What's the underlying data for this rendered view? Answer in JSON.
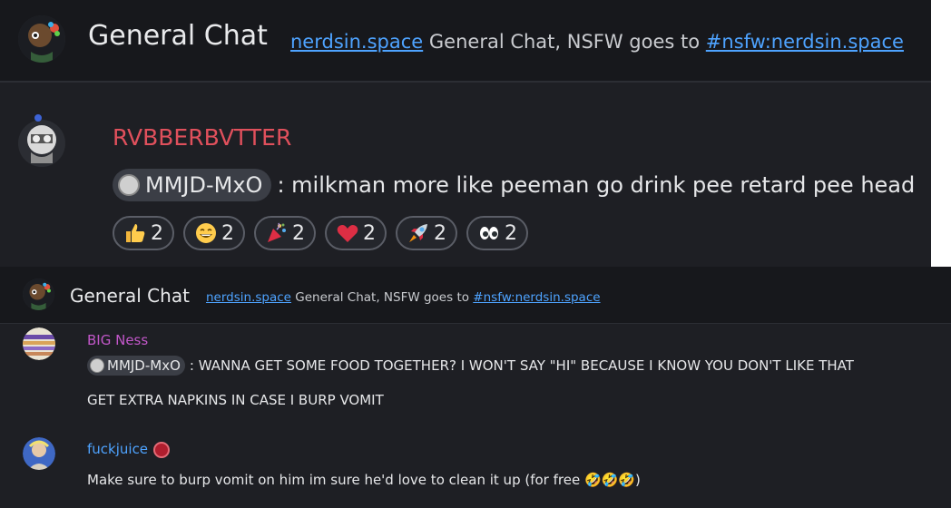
{
  "panel_zoomed": {
    "room": {
      "title": "General Chat",
      "topic_link1": "nerdsin.space",
      "topic_text": "General Chat, NSFW goes to",
      "topic_link2": "#nsfw:nerdsin.space"
    },
    "message": {
      "sender": "RVBBERBVTTER",
      "mention": "MMJD-MxO",
      "text": ": milkman more like peeman go drink pee retard pee head",
      "reactions": [
        {
          "emoji": "thumbs-up",
          "count": "2"
        },
        {
          "emoji": "grinning-face",
          "count": "2"
        },
        {
          "emoji": "party-popper",
          "count": "2"
        },
        {
          "emoji": "red-heart",
          "count": "2"
        },
        {
          "emoji": "rocket",
          "count": "2"
        },
        {
          "emoji": "eyes",
          "count": "2"
        }
      ]
    }
  },
  "panel_normal": {
    "room": {
      "title": "General Chat",
      "topic_link1": "nerdsin.space",
      "topic_text": "General Chat, NSFW goes to",
      "topic_link2": "#nsfw:nerdsin.space"
    },
    "messages": [
      {
        "sender": "BIG Ness",
        "sender_color": "#c257c9",
        "mention": "MMJD-MxO",
        "line1": ": WANNA GET SOME FOOD TOGETHER? I WON'T SAY \"HI\" BECAUSE I KNOW YOU DON'T LIKE THAT",
        "line2": "GET EXTRA NAPKINS IN CASE I BURP VOMIT"
      },
      {
        "sender": "fuckjuice",
        "sender_color": "#4ea3ff",
        "line1": "Make sure to burp vomit on him im sure he'd love to clean it up (for free 🤣🤣🤣)"
      }
    ]
  },
  "colors": {
    "background": "#1e1f24",
    "header": "#17181c",
    "link": "#4ea3ff",
    "sender_red": "#e0505c"
  }
}
